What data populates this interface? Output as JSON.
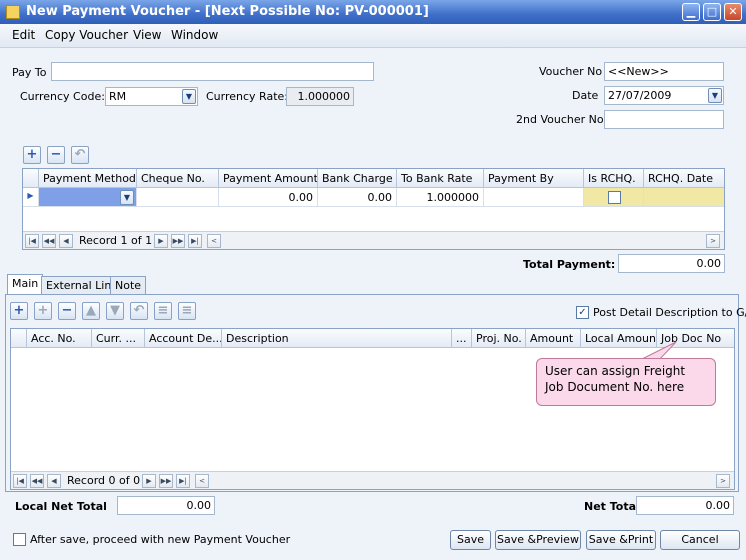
{
  "window": {
    "title": "New Payment Voucher - [Next Possible No: PV-000001]"
  },
  "menu": [
    "Edit",
    "Copy Voucher",
    "View",
    "Window"
  ],
  "header": {
    "pay_to_label": "Pay To",
    "pay_to_value": "",
    "currency_code_label": "Currency Code:",
    "currency_code_value": "RM",
    "currency_rate_label": "Currency Rate:",
    "currency_rate_value": "1.000000",
    "voucher_no_label": "Voucher No",
    "voucher_no_value": "<<New>>",
    "date_label": "Date",
    "date_value": "27/07/2009",
    "second_voucher_label": "2nd Voucher No",
    "second_voucher_value": ""
  },
  "payment_grid": {
    "columns": [
      "Payment Method",
      "Cheque No.",
      "Payment Amount",
      "Bank Charge",
      "To Bank Rate",
      "Payment By",
      "Is RCHQ.",
      "RCHQ. Date"
    ],
    "row": {
      "payment_method": "",
      "cheque_no": "",
      "payment_amount": "0.00",
      "bank_charge": "0.00",
      "to_bank_rate": "1.000000",
      "payment_by": "",
      "rchq_date": ""
    },
    "record_text": "Record 1 of 1"
  },
  "totals": {
    "total_payment_label": "Total Payment:",
    "total_payment_value": "0.00"
  },
  "tabs": [
    "Main",
    "External Link",
    "Note"
  ],
  "detail": {
    "post_detail_label": "Post Detail Description to G/L",
    "columns": [
      "Acc. No.",
      "Curr. ...",
      "Account De...",
      "Description",
      "...",
      "Proj. No.",
      "Amount",
      "Local Amount",
      "Job Doc No"
    ],
    "record_text": "Record 0 of 0",
    "callout": "User can assign Freight Job Document No. here"
  },
  "footer": {
    "local_net_total_label": "Local Net Total",
    "local_net_total_value": "0.00",
    "net_total_label": "Net Total",
    "net_total_value": "0.00",
    "after_save_label": "After save, proceed with new Payment Voucher",
    "buttons": {
      "save": "Save",
      "save_preview": "Save &Preview",
      "save_print": "Save &Print",
      "cancel": "Cancel"
    }
  }
}
